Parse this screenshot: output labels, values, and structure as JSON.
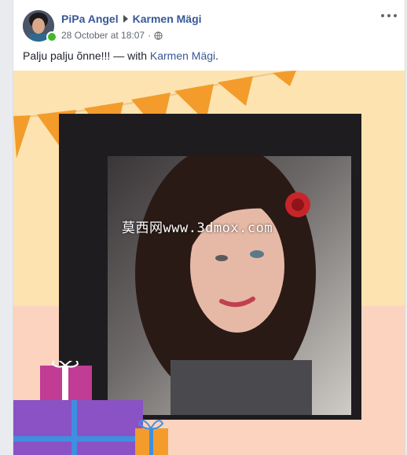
{
  "post": {
    "author": "PiPa Angel",
    "recipient": "Karmen Mägi",
    "timestamp": "28 October at 18:07",
    "text_prefix": "Palju palju õnne!!! — with ",
    "tagged_name": "Karmen Mägi",
    "text_suffix": ".",
    "privacy_icon": "globe-icon",
    "options_icon": "more-options-icon"
  },
  "photo": {
    "watermark": "莫西网www.3dmox.com"
  },
  "colors": {
    "link_blue": "#385898",
    "online_green": "#42b72a",
    "bunting_orange": "#f39c2b",
    "bg_peach": "#fde3b0"
  }
}
